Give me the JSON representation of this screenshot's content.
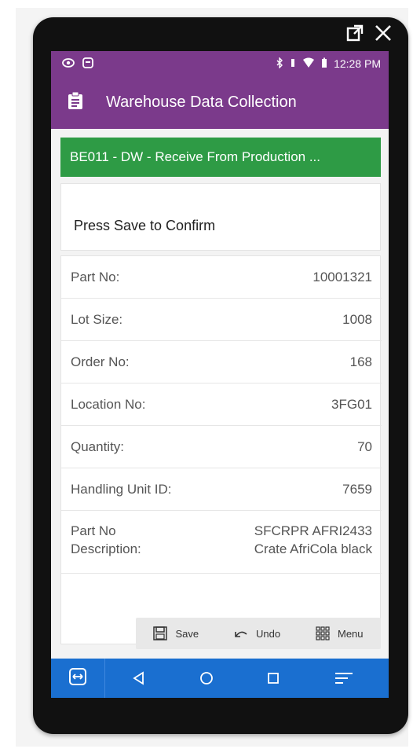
{
  "device_controls": {
    "icons": [
      "external-link-icon",
      "close-icon"
    ]
  },
  "statusbar": {
    "time": "12:28 PM"
  },
  "appbar": {
    "title": "Warehouse Data Collection"
  },
  "task": {
    "title": "BE011 - DW - Receive From Production ..."
  },
  "message": {
    "text": "Press Save to Confirm"
  },
  "details": {
    "rows": [
      {
        "label": "Part No:",
        "value": "10001321"
      },
      {
        "label": "Lot Size:",
        "value": "1008"
      },
      {
        "label": "Order No:",
        "value": "168"
      },
      {
        "label": "Location No:",
        "value": "3FG01"
      },
      {
        "label": "Quantity:",
        "value": "70"
      },
      {
        "label": "Handling Unit ID:",
        "value": "7659"
      }
    ],
    "description": {
      "label_line1": "Part No",
      "label_line2": "Description:",
      "value_line1": "SFCRPR AFRI2433",
      "value_line2": "Crate AfriCola black"
    }
  },
  "toolbar": {
    "save_label": "Save",
    "undo_label": "Undo",
    "menu_label": "Menu"
  },
  "colors": {
    "appbar": "#7b3a8b",
    "banner": "#2e9b45",
    "navbar": "#1a6fd0"
  }
}
